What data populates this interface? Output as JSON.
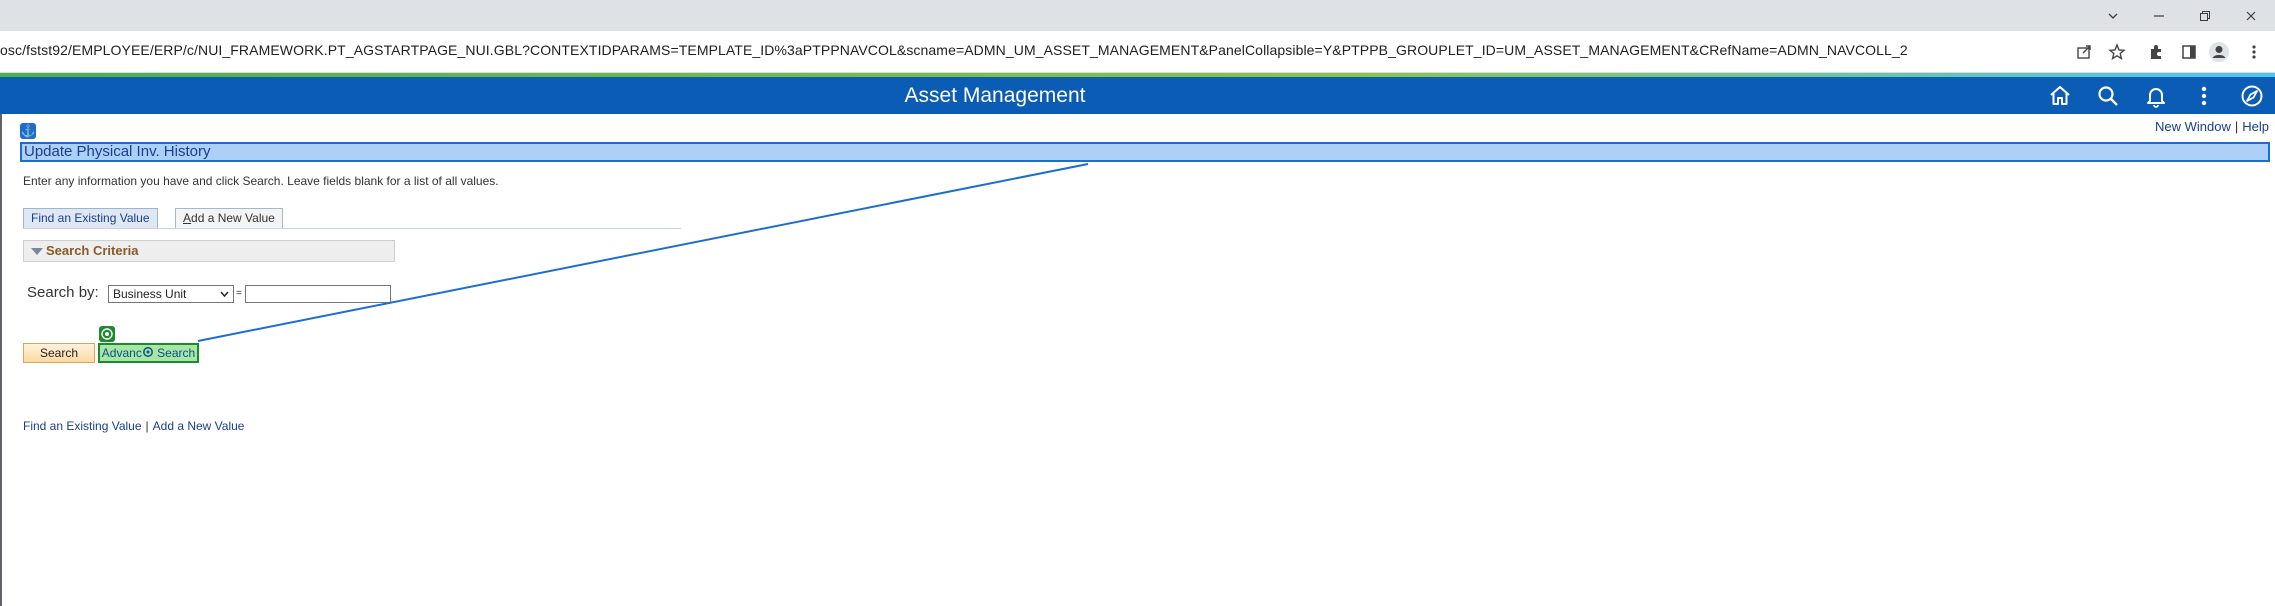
{
  "browser": {
    "url": "osc/fstst92/EMPLOYEE/ERP/c/NUI_FRAMEWORK.PT_AGSTARTPAGE_NUI.GBL?CONTEXTIDPARAMS=TEMPLATE_ID%3aPTPPNAVCOL&scname=ADMN_UM_ASSET_MANAGEMENT&PanelCollapsible=Y&PTPPB_GROUPLET_ID=UM_ASSET_MANAGEMENT&CRefName=ADMN_NAVCOLL_2",
    "window_controls": [
      "chevron-down-icon",
      "minimize-icon",
      "restore-icon",
      "close-icon"
    ],
    "toolbar_icons": [
      "share-icon",
      "star-icon",
      "extensions-icon",
      "sidepanel-icon",
      "profile-icon",
      "menu-icon"
    ]
  },
  "header": {
    "title": "Asset Management",
    "icons": [
      "home-icon",
      "search-icon",
      "bell-icon",
      "more-icon",
      "navbar-icon"
    ],
    "accent_color": "#0b5cb5"
  },
  "toplinks": {
    "new_window": "New Window",
    "help": "Help"
  },
  "page": {
    "title": "Update Physical Inv. History",
    "instructions": "Enter any information you have and click Search. Leave fields blank for a list of all values."
  },
  "tabs": {
    "find_existing": "Find an Existing Value",
    "add_new_prefix": "A",
    "add_new_rest": "dd a New Value"
  },
  "search": {
    "criteria_label": "Search Criteria",
    "search_by_label": "Search by:",
    "search_by_value": "Business Unit",
    "operator": "=",
    "field_value": "",
    "search_button": "Search",
    "advanced_part1": "Advanc",
    "advanced_part2": " Search"
  },
  "bottom_links": {
    "find_existing": "Find an Existing Value",
    "add_new": "Add a New Value"
  },
  "overlay_colors": {
    "selection_blue": "#1b6dd1",
    "selection_green": "#1c8a2e"
  }
}
